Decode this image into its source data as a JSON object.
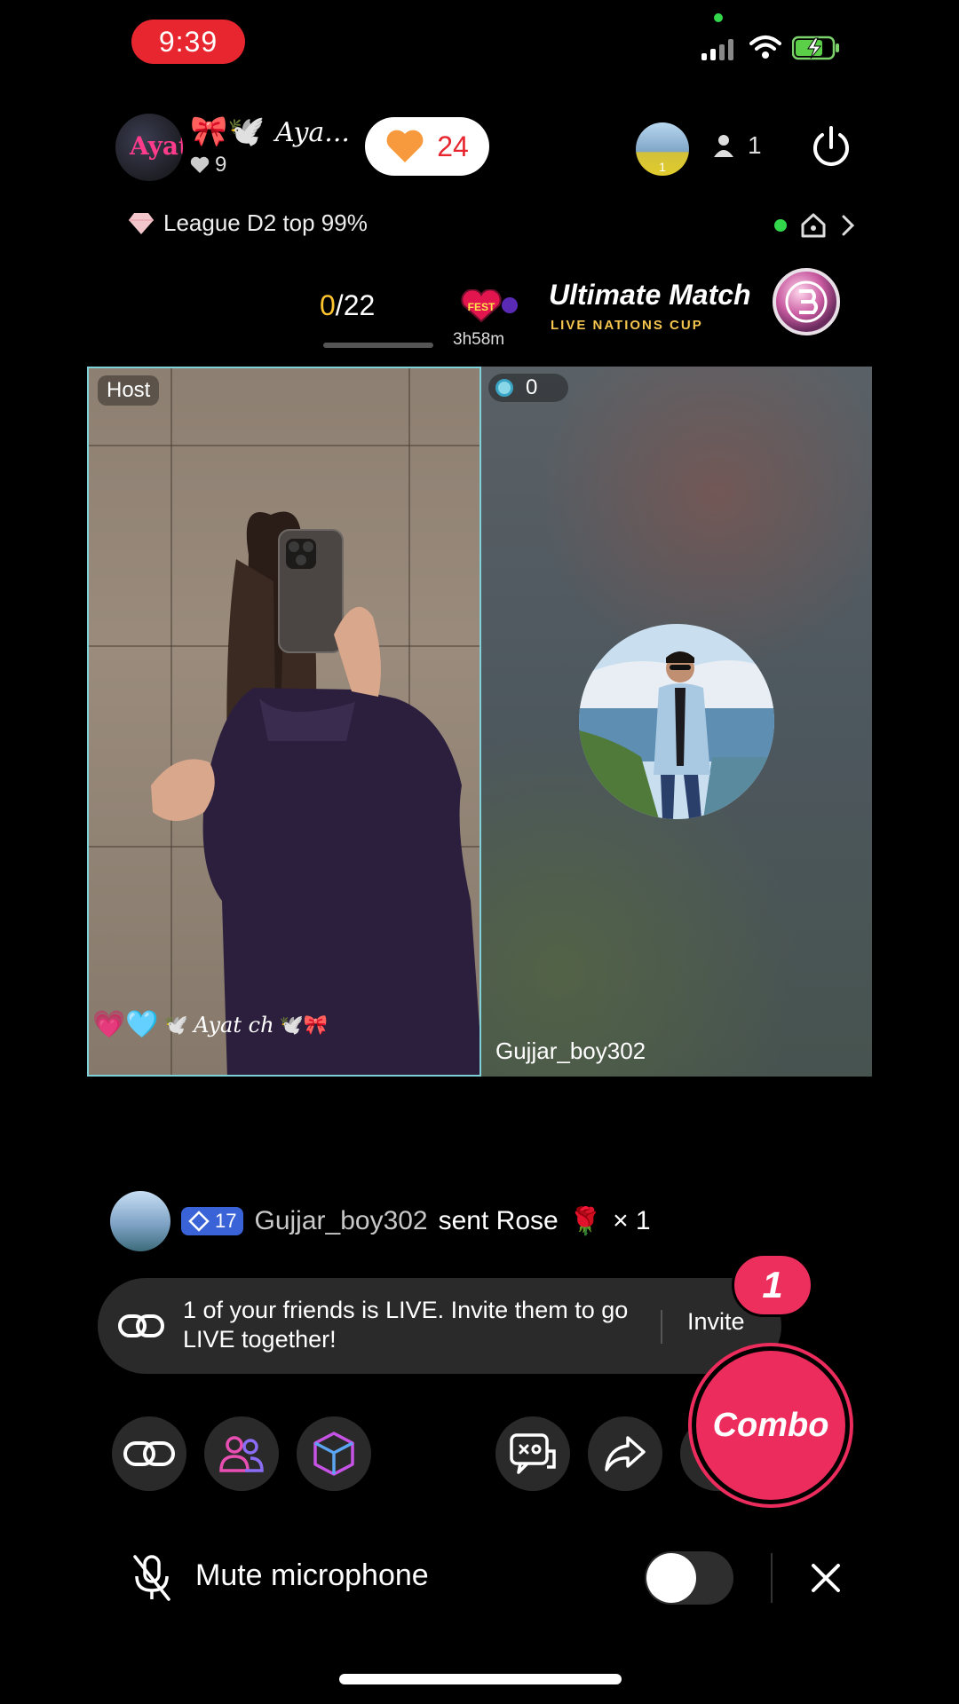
{
  "status_bar": {
    "time": "9:39"
  },
  "host": {
    "name": "Aya...",
    "likes": "9",
    "initials": "Ayat"
  },
  "likes_pill": {
    "count": "24"
  },
  "top_viewer": {
    "rank": "1"
  },
  "viewers": {
    "count": "1"
  },
  "league": {
    "text": "League D2 top 99%"
  },
  "match": {
    "score_current": "0",
    "score_total": "/22",
    "timer": "3h58m",
    "title": "Ultimate Match",
    "subtitle": "LIVE NATIONS CUP"
  },
  "left_panel": {
    "tag": "Host",
    "caption": "Ayat ch"
  },
  "right_panel": {
    "score": "0",
    "username": "Gujjar_boy302"
  },
  "feed": {
    "level": "17",
    "user": "Gujjar_boy302",
    "message": "sent Rose",
    "gift_emoji": "🌹",
    "multiplier": "× 1"
  },
  "invite": {
    "message": "1 of your friends is LIVE. Invite them to go LIVE together!",
    "button": "Invite",
    "badge": "1"
  },
  "combo": {
    "label": "Combo"
  },
  "bottom": {
    "mute_label": "Mute microphone"
  },
  "colors": {
    "accent_red": "#e8262f",
    "combo_pink": "#ec2c5c",
    "score_yellow": "#ffc42e",
    "level_blue": "#3b63d8"
  }
}
